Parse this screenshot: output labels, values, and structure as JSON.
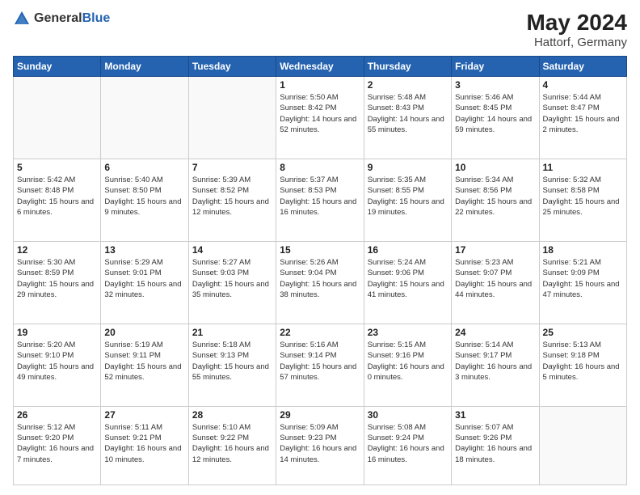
{
  "logo": {
    "text_general": "General",
    "text_blue": "Blue"
  },
  "title": {
    "month_year": "May 2024",
    "location": "Hattorf, Germany"
  },
  "headers": [
    "Sunday",
    "Monday",
    "Tuesday",
    "Wednesday",
    "Thursday",
    "Friday",
    "Saturday"
  ],
  "weeks": [
    [
      {
        "day": "",
        "info": ""
      },
      {
        "day": "",
        "info": ""
      },
      {
        "day": "",
        "info": ""
      },
      {
        "day": "1",
        "info": "Sunrise: 5:50 AM\nSunset: 8:42 PM\nDaylight: 14 hours and 52 minutes."
      },
      {
        "day": "2",
        "info": "Sunrise: 5:48 AM\nSunset: 8:43 PM\nDaylight: 14 hours and 55 minutes."
      },
      {
        "day": "3",
        "info": "Sunrise: 5:46 AM\nSunset: 8:45 PM\nDaylight: 14 hours and 59 minutes."
      },
      {
        "day": "4",
        "info": "Sunrise: 5:44 AM\nSunset: 8:47 PM\nDaylight: 15 hours and 2 minutes."
      }
    ],
    [
      {
        "day": "5",
        "info": "Sunrise: 5:42 AM\nSunset: 8:48 PM\nDaylight: 15 hours and 6 minutes."
      },
      {
        "day": "6",
        "info": "Sunrise: 5:40 AM\nSunset: 8:50 PM\nDaylight: 15 hours and 9 minutes."
      },
      {
        "day": "7",
        "info": "Sunrise: 5:39 AM\nSunset: 8:52 PM\nDaylight: 15 hours and 12 minutes."
      },
      {
        "day": "8",
        "info": "Sunrise: 5:37 AM\nSunset: 8:53 PM\nDaylight: 15 hours and 16 minutes."
      },
      {
        "day": "9",
        "info": "Sunrise: 5:35 AM\nSunset: 8:55 PM\nDaylight: 15 hours and 19 minutes."
      },
      {
        "day": "10",
        "info": "Sunrise: 5:34 AM\nSunset: 8:56 PM\nDaylight: 15 hours and 22 minutes."
      },
      {
        "day": "11",
        "info": "Sunrise: 5:32 AM\nSunset: 8:58 PM\nDaylight: 15 hours and 25 minutes."
      }
    ],
    [
      {
        "day": "12",
        "info": "Sunrise: 5:30 AM\nSunset: 8:59 PM\nDaylight: 15 hours and 29 minutes."
      },
      {
        "day": "13",
        "info": "Sunrise: 5:29 AM\nSunset: 9:01 PM\nDaylight: 15 hours and 32 minutes."
      },
      {
        "day": "14",
        "info": "Sunrise: 5:27 AM\nSunset: 9:03 PM\nDaylight: 15 hours and 35 minutes."
      },
      {
        "day": "15",
        "info": "Sunrise: 5:26 AM\nSunset: 9:04 PM\nDaylight: 15 hours and 38 minutes."
      },
      {
        "day": "16",
        "info": "Sunrise: 5:24 AM\nSunset: 9:06 PM\nDaylight: 15 hours and 41 minutes."
      },
      {
        "day": "17",
        "info": "Sunrise: 5:23 AM\nSunset: 9:07 PM\nDaylight: 15 hours and 44 minutes."
      },
      {
        "day": "18",
        "info": "Sunrise: 5:21 AM\nSunset: 9:09 PM\nDaylight: 15 hours and 47 minutes."
      }
    ],
    [
      {
        "day": "19",
        "info": "Sunrise: 5:20 AM\nSunset: 9:10 PM\nDaylight: 15 hours and 49 minutes."
      },
      {
        "day": "20",
        "info": "Sunrise: 5:19 AM\nSunset: 9:11 PM\nDaylight: 15 hours and 52 minutes."
      },
      {
        "day": "21",
        "info": "Sunrise: 5:18 AM\nSunset: 9:13 PM\nDaylight: 15 hours and 55 minutes."
      },
      {
        "day": "22",
        "info": "Sunrise: 5:16 AM\nSunset: 9:14 PM\nDaylight: 15 hours and 57 minutes."
      },
      {
        "day": "23",
        "info": "Sunrise: 5:15 AM\nSunset: 9:16 PM\nDaylight: 16 hours and 0 minutes."
      },
      {
        "day": "24",
        "info": "Sunrise: 5:14 AM\nSunset: 9:17 PM\nDaylight: 16 hours and 3 minutes."
      },
      {
        "day": "25",
        "info": "Sunrise: 5:13 AM\nSunset: 9:18 PM\nDaylight: 16 hours and 5 minutes."
      }
    ],
    [
      {
        "day": "26",
        "info": "Sunrise: 5:12 AM\nSunset: 9:20 PM\nDaylight: 16 hours and 7 minutes."
      },
      {
        "day": "27",
        "info": "Sunrise: 5:11 AM\nSunset: 9:21 PM\nDaylight: 16 hours and 10 minutes."
      },
      {
        "day": "28",
        "info": "Sunrise: 5:10 AM\nSunset: 9:22 PM\nDaylight: 16 hours and 12 minutes."
      },
      {
        "day": "29",
        "info": "Sunrise: 5:09 AM\nSunset: 9:23 PM\nDaylight: 16 hours and 14 minutes."
      },
      {
        "day": "30",
        "info": "Sunrise: 5:08 AM\nSunset: 9:24 PM\nDaylight: 16 hours and 16 minutes."
      },
      {
        "day": "31",
        "info": "Sunrise: 5:07 AM\nSunset: 9:26 PM\nDaylight: 16 hours and 18 minutes."
      },
      {
        "day": "",
        "info": ""
      }
    ]
  ]
}
